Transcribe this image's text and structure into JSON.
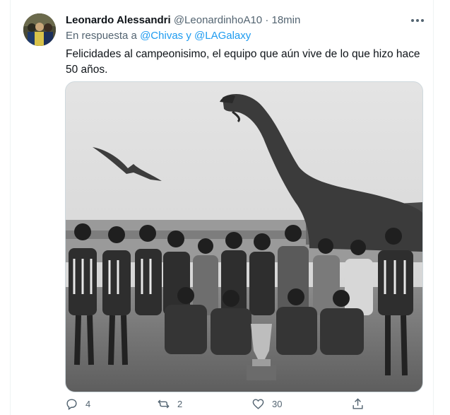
{
  "tweet": {
    "author_name": "Leonardo Alessandri",
    "author_handle": "@LeonardinhoA10",
    "separator": "·",
    "time": "18min",
    "reply_prefix": "En respuesta a",
    "reply_mention_1": "@Chivas",
    "reply_conjunction": "y",
    "reply_mention_2": "@LAGalaxy",
    "text": "Felicidades al campeonisimo, el equipo que aún vive de lo que hizo hace 50 años.",
    "media_description_icon": "photo"
  },
  "actions": {
    "reply_count": "4",
    "retweet_count": "2",
    "like_count": "30"
  },
  "icons": {
    "more": "more-horizontal-icon",
    "reply": "reply-icon",
    "retweet": "retweet-icon",
    "like": "heart-icon",
    "share": "share-icon"
  },
  "colors": {
    "link": "#1d9bf0",
    "muted": "#536471",
    "text": "#0f1419"
  }
}
